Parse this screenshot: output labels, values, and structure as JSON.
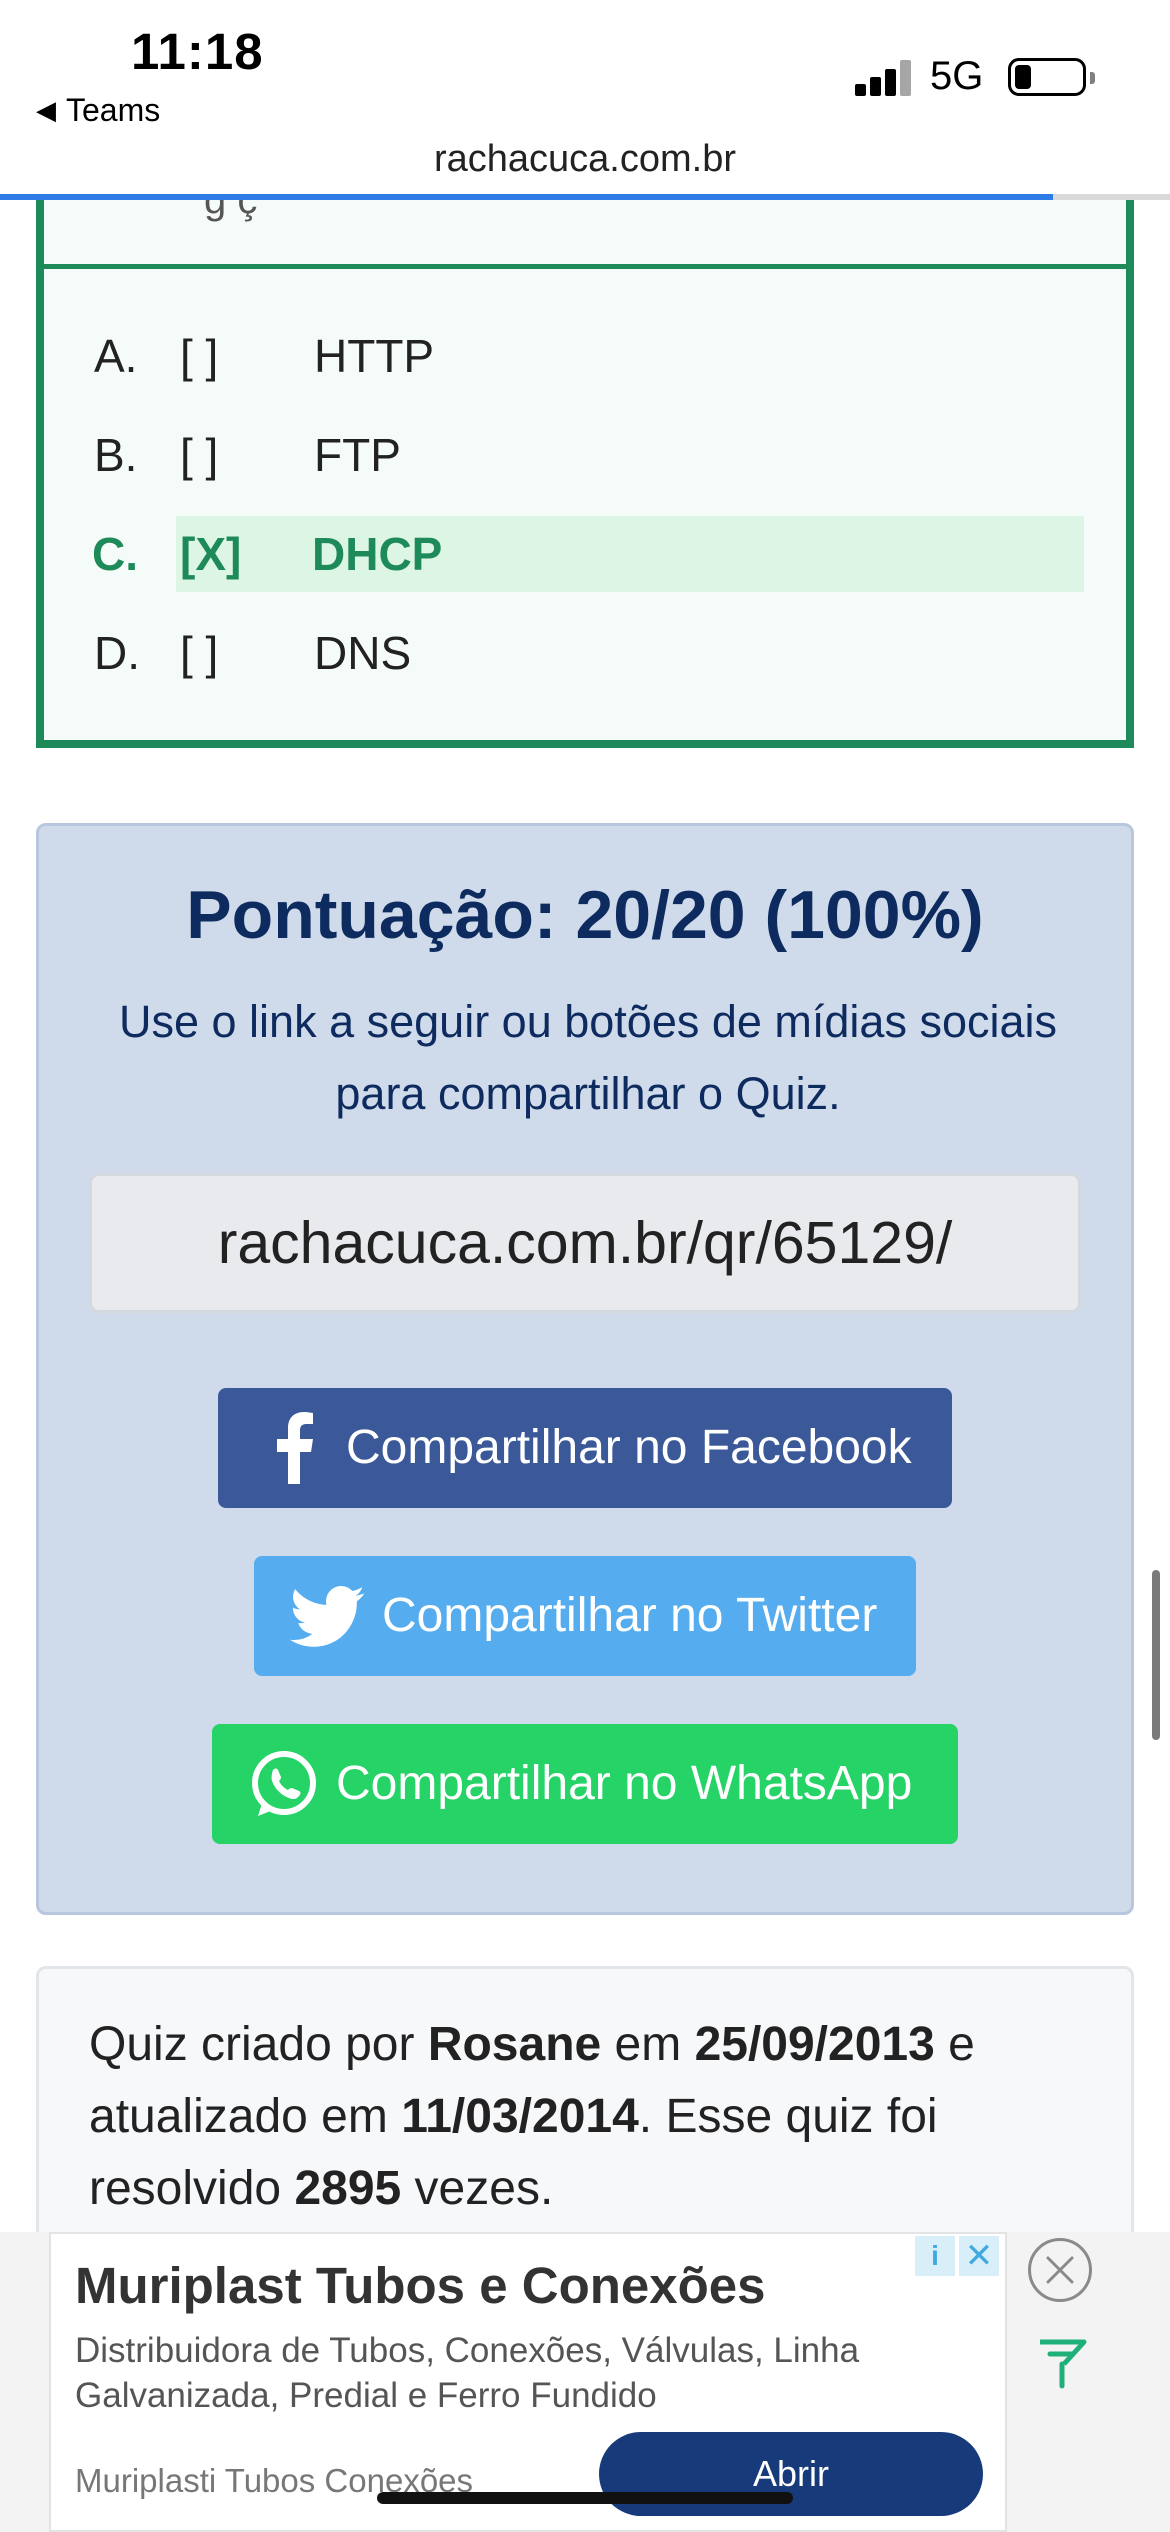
{
  "status_bar": {
    "time": "11:18",
    "back_app": "Teams",
    "back_icon": "back-triangle-icon",
    "network": "5G",
    "url": "rachacuca.com.br",
    "load_progress": 0.9
  },
  "question": {
    "clipped_text": "   g    ç",
    "options": [
      {
        "letter": "A.",
        "box": "[  ]",
        "text": "HTTP",
        "selected": false
      },
      {
        "letter": "B.",
        "box": "[  ]",
        "text": "FTP",
        "selected": false
      },
      {
        "letter": "C.",
        "box": "[X]",
        "text": "DHCP",
        "selected": true
      },
      {
        "letter": "D.",
        "box": "[  ]",
        "text": "DNS",
        "selected": false
      }
    ]
  },
  "score": {
    "title": "Pontuação: 20/20 (100%)",
    "subtitle": "Use o link a seguir ou botões de mídias sociais para compartilhar o Quiz.",
    "share_link": "rachacuca.com.br/qr/65129/",
    "buttons": {
      "facebook": "Compartilhar no Facebook",
      "twitter": "Compartilhar no Twitter",
      "whatsapp": "Compartilhar no WhatsApp"
    }
  },
  "info": {
    "p1": "Quiz criado por ",
    "author": "Rosane",
    "p2": " em ",
    "created": "25/09/2013",
    "p3": " e atualizado em ",
    "updated": "11/03/2014",
    "p4": ". Esse quiz foi resolvido ",
    "count": "2895",
    "p5": " vezes."
  },
  "ad": {
    "title": "Muriplast Tubos e Conexões",
    "description": "Distribuidora de Tubos, Conexões, Válvulas, Linha Galvanizada, Predial e Ferro Fundido",
    "source": "Muriplasti Tubos Conexões",
    "cta": "Abrir",
    "info_glyph": "i",
    "x_glyph": "✕"
  },
  "colors": {
    "correct_green": "#1e8a5a",
    "score_blue": "#0d2b5e",
    "facebook": "#3b5998",
    "twitter": "#55acee",
    "whatsapp": "#25d366",
    "ad_button": "#163a7a"
  }
}
